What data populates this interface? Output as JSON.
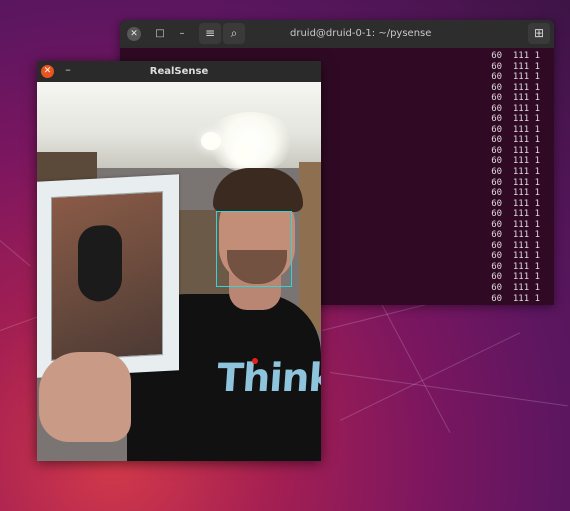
{
  "desktop": {
    "accent": "#e95420"
  },
  "terminal": {
    "title": "druid@druid-0-1: ~/pysense",
    "icons": {
      "close": "close-icon",
      "maximize": "maximize-icon",
      "minimize": "minimize-icon",
      "menu": "hamburger-menu-icon",
      "search": "search-icon",
      "new_tab": "new-tab-icon"
    },
    "output_lines": [
      "60  111 1",
      "60  111 1",
      "60  111 1",
      "60  111 1",
      "60  111 1",
      "60  111 1",
      "60  111 1",
      "60  111 1",
      "60  111 1",
      "60  111 1",
      "60  111 1",
      "60  111 1",
      "60  111 1",
      "60  111 1",
      "60  111 1",
      "60  111 1",
      "60  111 1",
      "60  111 1",
      "60  111 1",
      "60  111 1",
      "60  111 1",
      "60  111 1",
      "60  111 1",
      "60  111 1"
    ]
  },
  "realsense": {
    "title": "RealSense",
    "shirt_text": "Think",
    "face_box_color": "#34d4d4"
  }
}
